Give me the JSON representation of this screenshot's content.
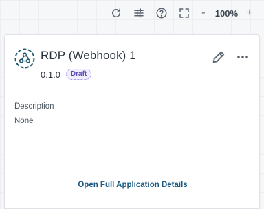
{
  "toolbar": {
    "refresh_icon": "refresh-icon",
    "settings_icon": "sliders-icon",
    "help_icon": "help-circle-icon",
    "fit_icon": "fit-screen-icon",
    "zoom_minus": "-",
    "zoom_level": "100%",
    "zoom_plus": "+"
  },
  "app": {
    "title": "RDP (Webhook) 1",
    "version": "0.1.0",
    "status": "Draft",
    "logo_icon": "webhook-icon",
    "edit_icon": "pencil-icon",
    "more_icon": "more-horizontal-icon"
  },
  "details": {
    "description_label": "Description",
    "description_value": "None"
  },
  "footer": {
    "open_link": "Open Full Application Details"
  },
  "colors": {
    "accent": "#1a5a82",
    "logo": "#215a6e",
    "badge_text": "#5b4bb0",
    "badge_bg": "#f1eefc"
  }
}
